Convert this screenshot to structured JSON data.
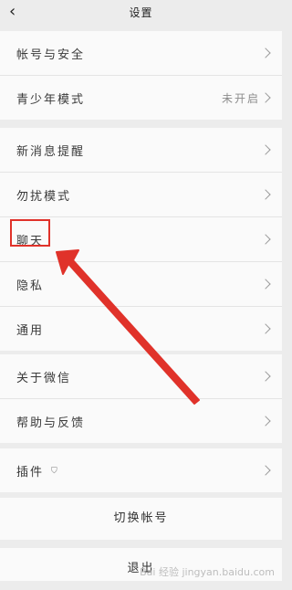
{
  "nav": {
    "back_icon": "chevron-left-icon",
    "title": "设置"
  },
  "group1": [
    {
      "label": "帐号与安全"
    },
    {
      "label": "青少年模式",
      "value": "未开启"
    }
  ],
  "group2": [
    {
      "label": "新消息提醒"
    },
    {
      "label": "勿扰模式"
    },
    {
      "label": "聊天"
    },
    {
      "label": "隐私"
    },
    {
      "label": "通用"
    }
  ],
  "group3": [
    {
      "label": "关于微信"
    },
    {
      "label": "帮助与反馈"
    }
  ],
  "group4": [
    {
      "label": "插件",
      "icon": "shield-icon"
    }
  ],
  "switch_account": "切换帐号",
  "logout": "退出",
  "watermark": "Bai 经验 jingyan.baidu.com",
  "annotation_color": "#e0322a"
}
